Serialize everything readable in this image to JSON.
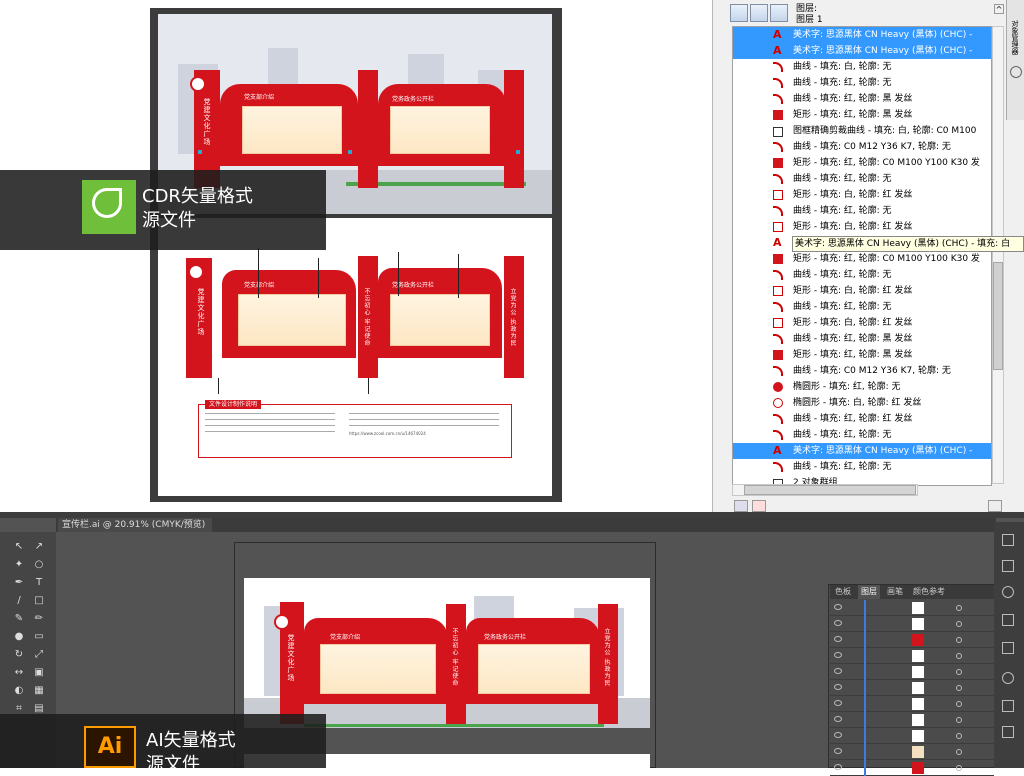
{
  "cdr": {
    "badge_title": "CDR矢量格式",
    "badge_subtitle": "源文件",
    "board": {
      "left_pillar_text": "党建文化广场",
      "panel1_title": "党支部介绍",
      "panel2_title": "党务政务公开栏",
      "center_pillar_text": "不忘初心 牢记使命",
      "right_pillar_text": "立党为公 执政为民",
      "design_note_title": "文件设计制作说明",
      "design_note_link": "https://www.zcool.com.cn/u/14674024"
    }
  },
  "object_manager": {
    "header_line1": "图层:",
    "header_line2": "图层 1",
    "side_tab_label": "对象管理器",
    "tooltip": "美术字: 思源黑体 CN Heavy (黑体) (CHC) - 填充: 白",
    "items": [
      {
        "label": "美术字: 思源黑体 CN Heavy (黑体) (CHC) -",
        "icon": "text-icon",
        "selected": true
      },
      {
        "label": "美术字: 思源黑体 CN Heavy (黑体) (CHC) -",
        "icon": "text-icon",
        "selected": true
      },
      {
        "label": "曲线 - 填充: 白, 轮廓: 无",
        "icon": "curve-icon",
        "selected": false
      },
      {
        "label": "曲线 - 填充: 红, 轮廓: 无",
        "icon": "curve-icon",
        "selected": false
      },
      {
        "label": "曲线 - 填充: 红, 轮廓: 黑 发丝",
        "icon": "curve-icon",
        "selected": false
      },
      {
        "label": "矩形 - 填充: 红, 轮廓: 黑 发丝",
        "icon": "rect-fill-icon",
        "selected": false
      },
      {
        "label": "图框精确剪裁曲线 - 填充: 白, 轮廓: C0 M100",
        "icon": "group-icon",
        "selected": false
      },
      {
        "label": "曲线 - 填充: C0 M12 Y36 K7, 轮廓: 无",
        "icon": "curve-icon",
        "selected": false
      },
      {
        "label": "矩形 - 填充: 红, 轮廓: C0 M100 Y100 K30 发",
        "icon": "rect-fill-icon",
        "selected": false
      },
      {
        "label": "曲线 - 填充: 红, 轮廓: 无",
        "icon": "curve-icon",
        "selected": false
      },
      {
        "label": "矩形 - 填充: 白, 轮廓: 红 发丝",
        "icon": "rect-outline-icon",
        "selected": false
      },
      {
        "label": "曲线 - 填充: 红, 轮廓: 无",
        "icon": "curve-icon",
        "selected": false
      },
      {
        "label": "矩形 - 填充: 白, 轮廓: 红 发丝",
        "icon": "rect-outline-icon",
        "selected": false
      },
      {
        "label": "美术字: 思源黑体 CN Heavy (黑体) (CHC) - 填充: 白",
        "icon": "text-icon",
        "selected": false
      },
      {
        "label": "矩形 - 填充: 红, 轮廓: C0 M100 Y100 K30 发",
        "icon": "rect-fill-icon",
        "selected": false
      },
      {
        "label": "曲线 - 填充: 红, 轮廓: 无",
        "icon": "curve-icon",
        "selected": false
      },
      {
        "label": "矩形 - 填充: 白, 轮廓: 红 发丝",
        "icon": "rect-outline-icon",
        "selected": false
      },
      {
        "label": "曲线 - 填充: 红, 轮廓: 无",
        "icon": "curve-icon",
        "selected": false
      },
      {
        "label": "矩形 - 填充: 白, 轮廓: 红 发丝",
        "icon": "rect-outline-icon",
        "selected": false
      },
      {
        "label": "曲线 - 填充: 红, 轮廓: 黑 发丝",
        "icon": "curve-icon",
        "selected": false
      },
      {
        "label": "矩形 - 填充: 红, 轮廓: 黑 发丝",
        "icon": "rect-fill-icon",
        "selected": false
      },
      {
        "label": "曲线 - 填充: C0 M12 Y36 K7, 轮廓: 无",
        "icon": "curve-icon",
        "selected": false
      },
      {
        "label": "椭圆形 - 填充: 红, 轮廓: 无",
        "icon": "ellipse-fill-icon",
        "selected": false
      },
      {
        "label": "椭圆形 - 填充: 白, 轮廓: 红 发丝",
        "icon": "ellipse-outline-icon",
        "selected": false
      },
      {
        "label": "曲线 - 填充: 红, 轮廓: 红 发丝",
        "icon": "curve-icon",
        "selected": false
      },
      {
        "label": "曲线 - 填充: 红, 轮廓: 无",
        "icon": "curve-icon",
        "selected": false
      },
      {
        "label": "美术字: 思源黑体 CN Heavy (黑体) (CHC) -",
        "icon": "text-icon",
        "selected": true
      },
      {
        "label": "曲线 - 填充: 红, 轮廓: 无",
        "icon": "curve-icon",
        "selected": false
      },
      {
        "label": "2 对象群组",
        "icon": "group-icon",
        "selected": false
      }
    ]
  },
  "illustrator": {
    "doc_tab": "宣传栏.ai @ 20.91% (CMYK/预览)",
    "badge_title": "AI矢量格式",
    "badge_subtitle": "源文件",
    "panel_tabs": [
      "色板",
      "图层",
      "画笔",
      "颜色参考"
    ],
    "active_tab": "图层",
    "layer_count": 11
  },
  "colors": {
    "party_red": "#d4141c",
    "selection_blue": "#3399ff",
    "corel_green": "#6fbf3b",
    "ai_orange": "#ff9a00"
  }
}
